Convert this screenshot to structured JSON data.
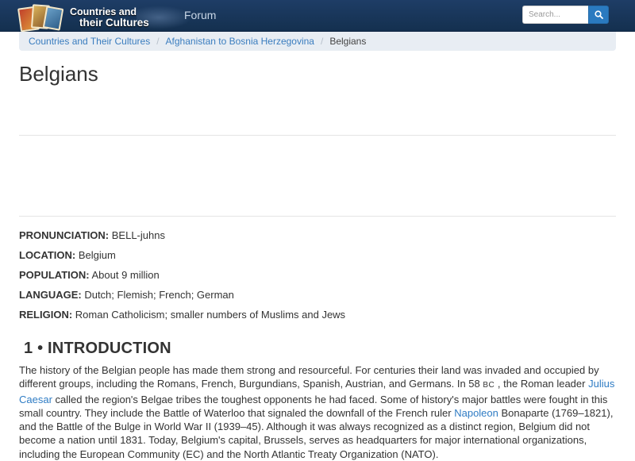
{
  "site": {
    "logo_line1": "Countries and",
    "logo_line2": "their Cultures",
    "nav_forum": "Forum",
    "search_placeholder": "Search..."
  },
  "breadcrumb": {
    "items": [
      "Countries and Their Cultures",
      "Afghanistan to Bosnia Herzegovina"
    ],
    "current": "Belgians",
    "separator": "/"
  },
  "page": {
    "title": "Belgians"
  },
  "facts": [
    {
      "label": "PRONUNCIATION:",
      "value": " BELL-juhns"
    },
    {
      "label": "LOCATION:",
      "value": " Belgium"
    },
    {
      "label": "POPULATION:",
      "value": " About 9 million"
    },
    {
      "label": "LANGUAGE:",
      "value": " Dutch; Flemish; French; German"
    },
    {
      "label": "RELIGION:",
      "value": " Roman Catholicism; smaller numbers of Muslims and Jews"
    }
  ],
  "section": {
    "heading": "1 • INTRODUCTION",
    "p1": "The history of the Belgian people has made them strong and resourceful. For centuries their land was invaded and occupied by different groups, including the Romans, French, Burgundians, Spanish, Austrian, and Germans. In 58 ",
    "bc": "BC",
    "p2": " , the Roman leader ",
    "link_caesar": "Julius Caesar",
    "p3": " called the region's Belgae tribes the toughest opponents he had faced. Some of history's major battles were fought in this small country. They include the Battle of Waterloo that signaled the downfall of the French ruler ",
    "link_napoleon": "Napoleon",
    "p4": " Bonaparte (1769–1821), and the Battle of the Bulge in World War II (1939–45). Although it was always recognized as a distinct region, Belgium did not become a nation until 1831. Today, Belgium's capital, Brussels, serves as headquarters for major international organizations, including the European Community (EC) and the North Atlantic Treaty Organization (NATO)."
  },
  "colors": {
    "navbar": "#1e3d66",
    "link": "#2f7cc4",
    "search_button": "#2a7ac0",
    "breadcrumb_bg": "#e8edf3"
  }
}
